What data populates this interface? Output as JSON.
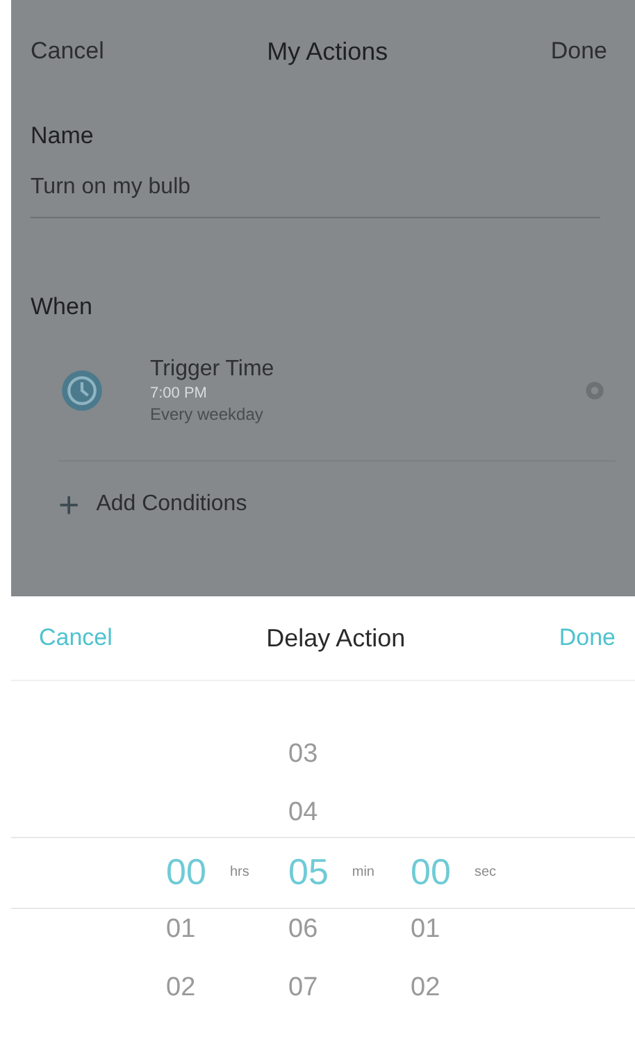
{
  "nav": {
    "cancel": "Cancel",
    "title": "My Actions",
    "done": "Done"
  },
  "name": {
    "label": "Name",
    "value": "Turn on my bulb"
  },
  "when": {
    "heading": "When",
    "triggers": [
      {
        "title": "Trigger Time",
        "time": "7:00 PM",
        "repeat": "Every weekday"
      }
    ],
    "add": "+",
    "add_label": "Add Conditions"
  },
  "sheet": {
    "cancel": "Cancel",
    "title": "Delay Action",
    "done": "Done",
    "columns": [
      {
        "unit": "hrs",
        "items": [
          {
            "value": "00",
            "selected": true
          },
          {
            "value": "01",
            "selected": false
          },
          {
            "value": "02",
            "selected": false
          }
        ]
      },
      {
        "unit": "min",
        "items": [
          {
            "value": "03",
            "selected": false
          },
          {
            "value": "04",
            "selected": false
          },
          {
            "value": "05",
            "selected": true
          },
          {
            "value": "06",
            "selected": false
          },
          {
            "value": "07",
            "selected": false
          }
        ]
      },
      {
        "unit": "sec",
        "items": [
          {
            "value": "00",
            "selected": true
          },
          {
            "value": "01",
            "selected": false
          },
          {
            "value": "02",
            "selected": false
          }
        ]
      }
    ]
  }
}
